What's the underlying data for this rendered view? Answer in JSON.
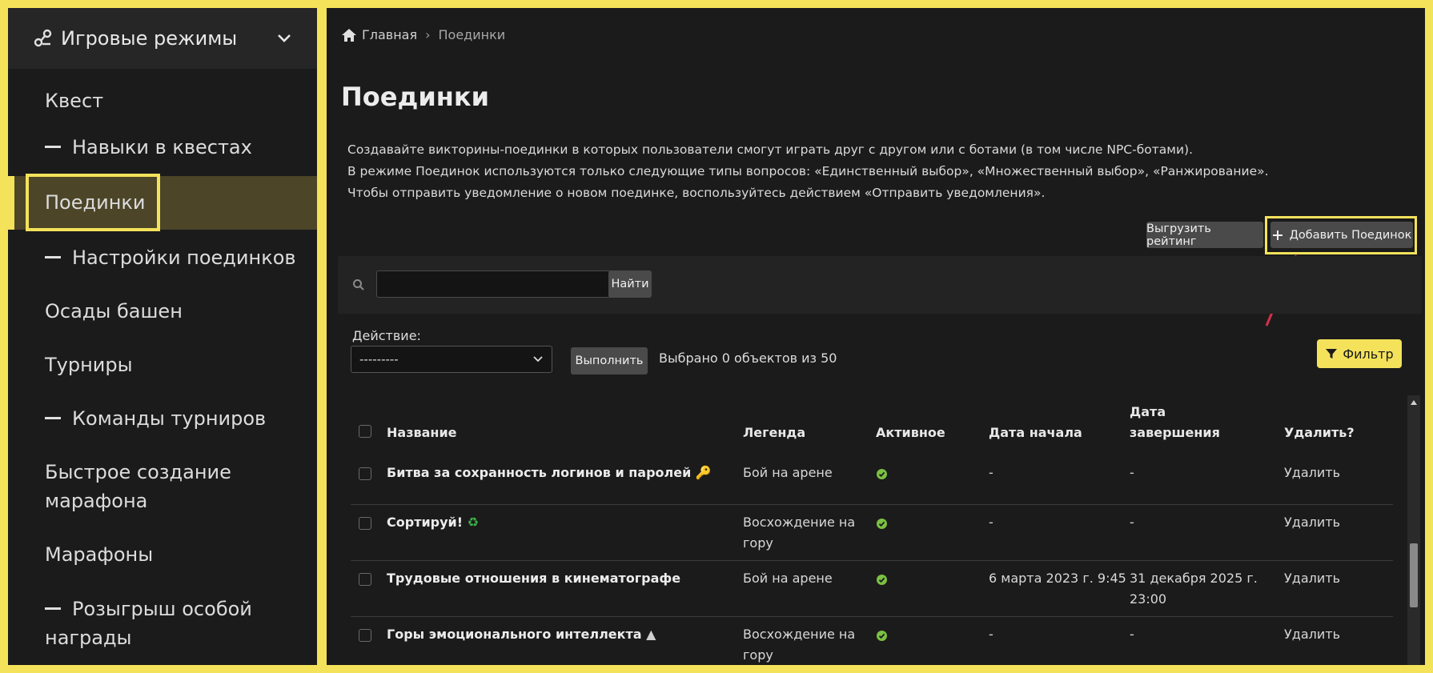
{
  "sidebar": {
    "header": "Игровые режимы",
    "items": [
      {
        "label": "Квест",
        "sub": false
      },
      {
        "label": "Навыки в квестах",
        "sub": true
      },
      {
        "label": "Поединки",
        "sub": false,
        "active": true
      },
      {
        "label": "Настройки поединков",
        "sub": true
      },
      {
        "label": "Осады башен",
        "sub": false
      },
      {
        "label": "Турниры",
        "sub": false
      },
      {
        "label": "Команды турниров",
        "sub": true
      },
      {
        "label": "Быстрое создание",
        "label2": "марафона",
        "sub": false
      },
      {
        "label": "Марафоны",
        "sub": false
      },
      {
        "label": "Розыгрыш особой",
        "label2": "награды",
        "sub": true
      }
    ]
  },
  "breadcrumb": {
    "home": "Главная",
    "separator": "›",
    "current": "Поединки"
  },
  "page": {
    "title": "Поединки",
    "description": [
      "Создавайте викторины-поединки в которых пользователи смогут играть друг с другом или с ботами (в том числе NPC-ботами).",
      "В режиме Поединок используются только следующие типы вопросов: «Единственный выбор», «Множественный выбор», «Ранжирование».",
      "Чтобы отправить уведомление о новом поединке, воспользуйтесь действием «Отправить уведомления»."
    ]
  },
  "toolbar": {
    "export_label": "Выгрузить рейтинг",
    "add_label": "Добавить Поединок"
  },
  "search": {
    "value": "",
    "button": "Найти"
  },
  "actions": {
    "label": "Действие:",
    "selected": "---------",
    "run": "Выполнить",
    "count": "Выбрано 0 объектов из 50"
  },
  "filter": {
    "label": "Фильтр"
  },
  "table": {
    "headers": {
      "name": "Название",
      "legend": "Легенда",
      "active": "Активное",
      "start": "Дата начала",
      "end1": "Дата",
      "end2": "завершения",
      "delete": "Удалить?"
    },
    "rows": [
      {
        "name": "Битва за сохранность логинов и паролей",
        "emoji": "🔑",
        "legend1": "Бой на арене",
        "legend2": "",
        "active": true,
        "start": "-",
        "end1": "-",
        "end2": "",
        "delete": "Удалить"
      },
      {
        "name": "Сортируй!",
        "emoji": "♻",
        "legend1": "Восхождение на",
        "legend2": "гору",
        "active": true,
        "start": "-",
        "end1": "-",
        "end2": "",
        "delete": "Удалить"
      },
      {
        "name": "Трудовые отношения в кинематографе",
        "emoji": "",
        "legend1": "Бой на арене",
        "legend2": "",
        "active": true,
        "start": "6 марта 2023 г. 9:45",
        "end1": "31 декабря 2025 г.",
        "end2": "23:00",
        "delete": "Удалить"
      },
      {
        "name": "Горы эмоционального интеллекта",
        "emoji": "▲",
        "legend1": "Восхождение на",
        "legend2": "гору",
        "active": true,
        "start": "-",
        "end1": "-",
        "end2": "",
        "delete": "Удалить"
      }
    ]
  },
  "colors": {
    "accent": "#f4e25a",
    "success": "#7bc043",
    "annotation_arrow": "#d4304a"
  }
}
